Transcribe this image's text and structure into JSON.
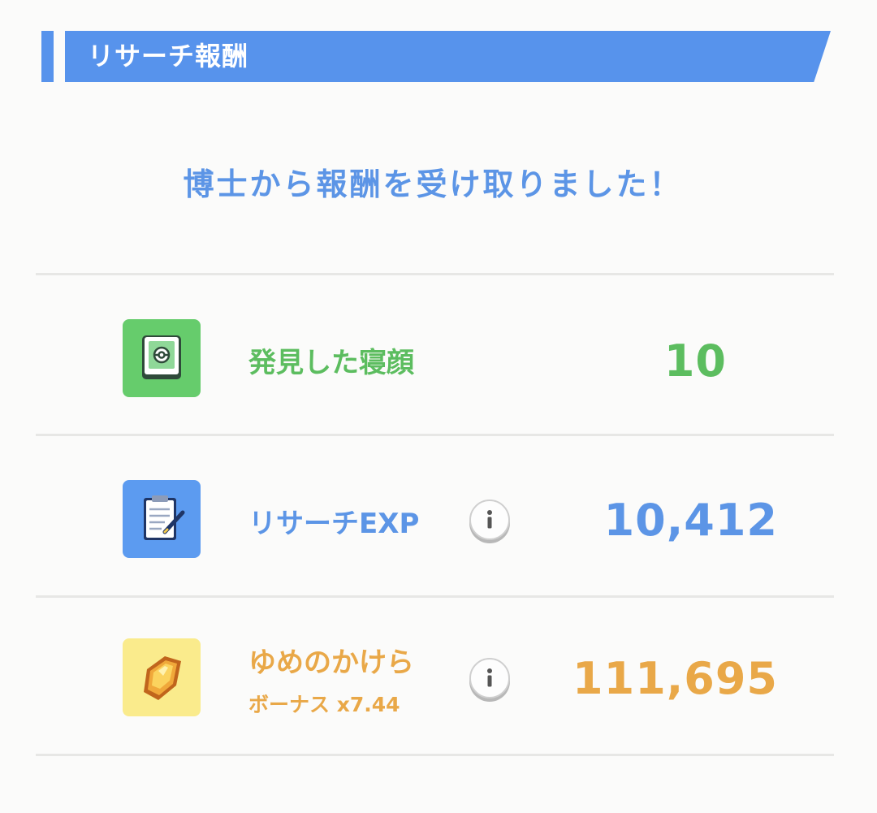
{
  "header": {
    "title": "リサーチ報酬"
  },
  "message": "博士から報酬を受け取りました！",
  "rewards": [
    {
      "label": "発見した寝顔",
      "value": "10",
      "icon": "sleep-style-book-icon",
      "color": "#5cbd5f",
      "tile_color": "#66cc6c"
    },
    {
      "label": "リサーチEXP",
      "value": "10,412",
      "icon": "research-clipboard-icon",
      "color": "#5c95e6",
      "tile_color": "#5c9bf0",
      "info_icon": "info-icon"
    },
    {
      "label": "ゆめのかけら",
      "sublabel": "ボーナス x7.44",
      "value": "111,695",
      "icon": "dream-shard-icon",
      "color": "#e9a848",
      "tile_color": "#faeb8c",
      "info_icon": "info-icon"
    }
  ],
  "colors": {
    "header_blue": "#5793ec",
    "message_blue": "#5c95e6",
    "divider": "#e7e7e5",
    "background": "#fbfbfa"
  }
}
